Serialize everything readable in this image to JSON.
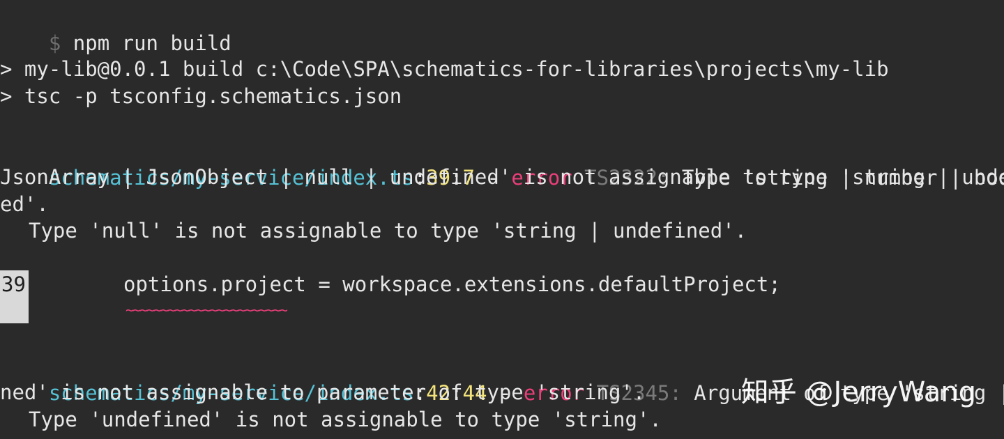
{
  "command": {
    "prompt": "$",
    "text": "npm run build"
  },
  "script_lines": [
    "> my-lib@0.0.1 build c:\\Code\\SPA\\schematics-for-libraries\\projects\\my-lib",
    "> tsc -p tsconfig.schematics.json"
  ],
  "errors": [
    {
      "file": "schematics/my-service/index.ts",
      "sep1": ":",
      "line": "39",
      "sep2": ":",
      "col": "7",
      "dash": " - ",
      "label": "error",
      "code": "TS2322:",
      "message_lines": [
        "Type 'string | number | boolean |",
        "JsonArray | JsonObject | null | undefined' is not assignable to type 'string | undefin",
        "ed'."
      ],
      "detail": "Type 'null' is not assignable to type 'string | undefined'.",
      "code_frame": {
        "line_number": "39",
        "source": "options.project = workspace.extensions.defaultProject;",
        "underline": "~~~~~~~~~~~~~~~~~~~~~~~"
      }
    },
    {
      "file": "schematics/my-service/index.ts",
      "sep1": ":",
      "line": "42",
      "sep2": ":",
      "col": "44",
      "dash": " - ",
      "label": "error",
      "code": "TS2345:",
      "message_lines": [
        "Argument of type 'string | undefi",
        "ned' is not assignable to parameter of type 'string'."
      ],
      "detail": "Type 'undefined' is not assignable to type 'string'."
    }
  ],
  "watermark": "知乎 @JerryWang",
  "colors": {
    "background": "#2a2a2a",
    "text": "#e6e6e6",
    "path": "#56c2d6",
    "position": "#f2e27a",
    "error": "#ea3f7b",
    "code": "#7a7a7a"
  }
}
